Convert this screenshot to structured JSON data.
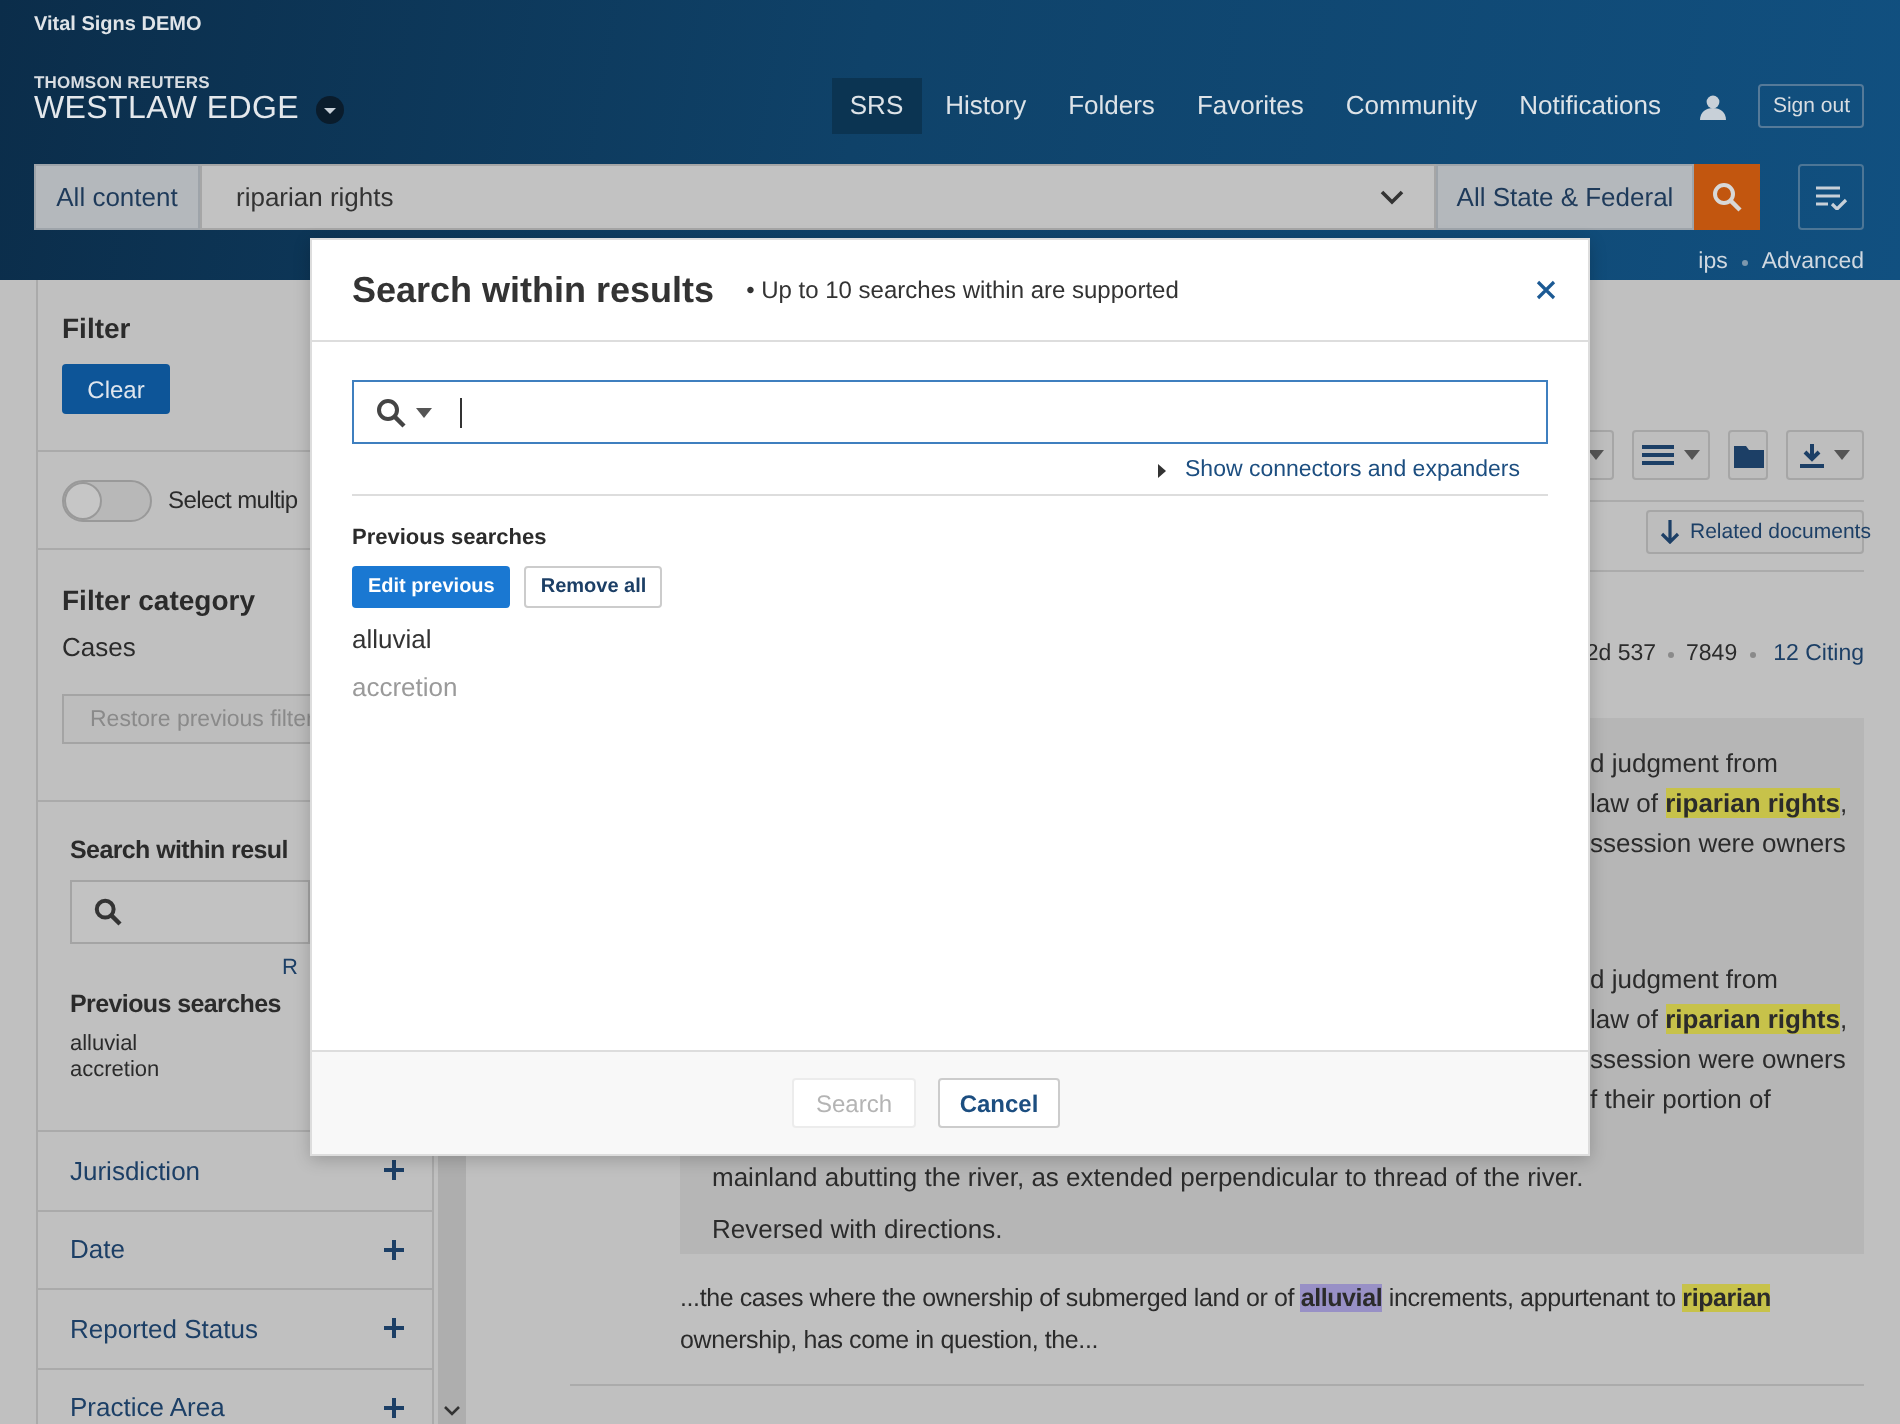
{
  "banner": {
    "label": "Vital Signs DEMO"
  },
  "brand": {
    "company": "THOMSON REUTERS",
    "product": "WESTLAW EDGE"
  },
  "nav": [
    {
      "label": "SRS",
      "selected": true
    },
    {
      "label": "History",
      "selected": false
    },
    {
      "label": "Folders",
      "selected": false
    },
    {
      "label": "Favorites",
      "selected": false
    },
    {
      "label": "Community",
      "selected": false
    },
    {
      "label": "Notifications",
      "selected": false
    }
  ],
  "sign_out": "Sign out",
  "search_bar": {
    "scope": "All content",
    "query": "riparian rights",
    "jurisdiction": "All State & Federal"
  },
  "search_links": [
    "ips",
    "Advanced"
  ],
  "sidebar": {
    "filter_title": "Filter",
    "clear_button": "Clear",
    "toggle": {
      "label": "Select multip",
      "on": false
    },
    "category_title": "Filter category",
    "category": "Cases",
    "restore_button": "Restore previous filter",
    "within_title": "Search within resul",
    "within_link": "R",
    "previous_title": "Previous searches",
    "previous": [
      "alluvial",
      "accretion"
    ],
    "facets": [
      {
        "label": "Jurisdiction",
        "expanded": false
      },
      {
        "label": "Date",
        "expanded": false
      },
      {
        "label": "Reported Status",
        "expanded": false
      },
      {
        "label": "Practice Area",
        "expanded": false
      }
    ]
  },
  "toolbar": {
    "related_button": "Related documents"
  },
  "result": {
    "meta": [
      "2d 537",
      "7849"
    ],
    "citing": "12 Citing",
    "paragraphs": [
      {
        "lines": [
          {
            "kind": "clipped",
            "segments": [
              {
                "text": "d judgment from"
              }
            ]
          },
          {
            "kind": "clipped",
            "segments": [
              {
                "text": "law of "
              },
              {
                "text": "riparian rights",
                "kind": "term"
              },
              {
                "text": ","
              }
            ]
          },
          {
            "kind": "clipped",
            "segments": [
              {
                "text": "ssession were owners"
              }
            ]
          }
        ]
      },
      {
        "lines": [
          {
            "kind": "clipped",
            "segments": [
              {
                "text": "d judgment from"
              }
            ]
          },
          {
            "kind": "clipped",
            "segments": [
              {
                "text": "law of "
              },
              {
                "text": "riparian rights",
                "kind": "term"
              },
              {
                "text": ","
              }
            ]
          },
          {
            "kind": "clipped",
            "segments": [
              {
                "text": "ssession were owners"
              }
            ]
          },
          {
            "kind": "clipped",
            "segments": [
              {
                "text": "f their portion of"
              }
            ]
          },
          {
            "kind": "full",
            "segments": [
              {
                "text": "mainland abutting the river, as extended perpendicular to thread of the river."
              }
            ]
          }
        ]
      },
      {
        "lines": [
          {
            "kind": "full",
            "segments": [
              {
                "text": "Reversed with directions."
              }
            ]
          }
        ]
      }
    ],
    "snippet": [
      {
        "text": "...the cases where the ownership of submerged land or of "
      },
      {
        "text": "alluvial",
        "kind": "within"
      },
      {
        "text": " increments, appurtenant to "
      },
      {
        "text": "riparian",
        "kind": "term"
      },
      {
        "text": " ownership, has come in question, the..."
      }
    ]
  },
  "modal": {
    "title": "Search within results",
    "note": "• Up to 10 searches within are supported",
    "connectors_link": "Show connectors and expanders",
    "previous_title": "Previous searches",
    "edit_button": "Edit previous",
    "remove_button": "Remove all",
    "previous": [
      {
        "text": "alluvial",
        "active": true
      },
      {
        "text": "accretion",
        "active": false
      }
    ],
    "search_button": {
      "label": "Search",
      "disabled": true
    },
    "cancel_button": "Cancel"
  }
}
